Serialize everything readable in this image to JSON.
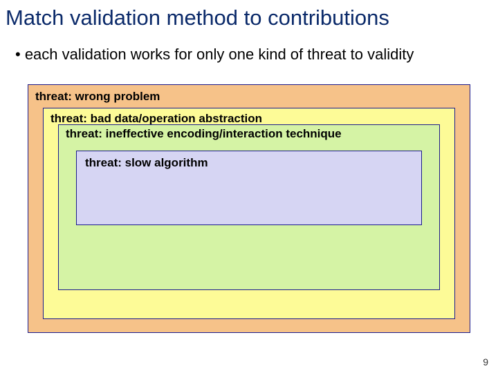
{
  "title": "Match validation method to contributions",
  "bullet": "• each validation works for only one kind of threat to validity",
  "layers": {
    "l1": "threat: wrong problem",
    "l2": "threat: bad data/operation abstraction",
    "l3": "threat: ineffective encoding/interaction technique",
    "l4": "threat: slow algorithm"
  },
  "page_number": "9"
}
